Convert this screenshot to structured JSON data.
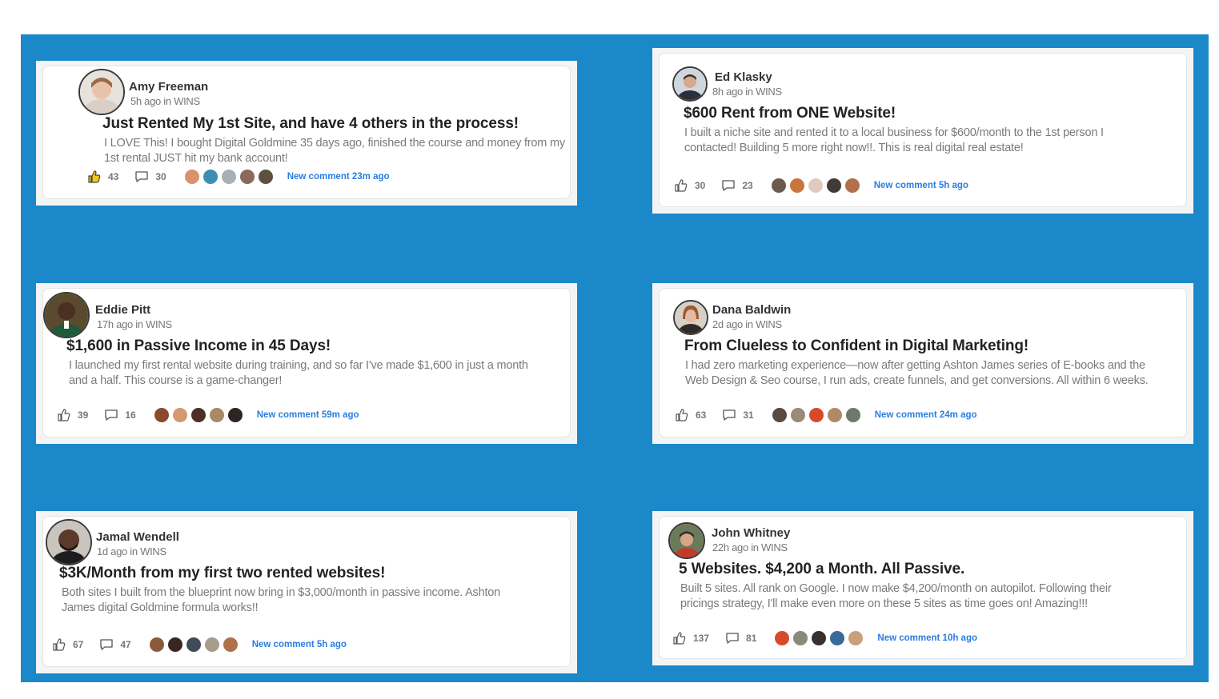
{
  "colors": {
    "background_panel": "#1a88c9",
    "link": "#2a7de1"
  },
  "posts": [
    {
      "author": "Amy Freeman",
      "meta": "5h ago in WINS",
      "title": "Just Rented My 1st Site, and have 4 others in the process!",
      "body": "I LOVE This!  I bought Digital Goldmine 35 days ago, finished the course and money from my 1st rental JUST hit my bank account!",
      "likes": "43",
      "comments": "30",
      "new_comment": "New comment 23m ago",
      "liked": true
    },
    {
      "author": "Ed Klasky",
      "meta": "8h ago in WINS",
      "title": "$600 Rent from ONE Website!",
      "body": "I built a niche site and rented it to a local business for $600/month to the 1st person I contacted! Building 5 more right now!!. This is real digital real estate!",
      "likes": "30",
      "comments": "23",
      "new_comment": "New comment 5h ago",
      "liked": false
    },
    {
      "author": "Eddie Pitt",
      "meta": "17h ago in WINS",
      "title": "$1,600 in Passive Income in 45 Days!",
      "body": "I launched my first rental website during training, and so far I've made $1,600 in just a month and a half. This course is a game-changer!",
      "likes": "39",
      "comments": "16",
      "new_comment": "New comment 59m ago",
      "liked": false
    },
    {
      "author": "Dana Baldwin",
      "meta": "2d ago in WINS",
      "title": "From Clueless to Confident in Digital Marketing!",
      "body": "I had zero marketing experience—now after getting Ashton James series of E-books and the Web Design & Seo course, I run ads, create funnels, and get conversions. All within 6 weeks.",
      "likes": "63",
      "comments": "31",
      "new_comment": "New comment 24m ago",
      "liked": false
    },
    {
      "author": "Jamal Wendell",
      "meta": "1d ago in WINS",
      "title": "$3K/Month from my first two rented websites!",
      "body": "Both sites I built from the blueprint now bring in $3,000/month in passive income. Ashton James digital Goldmine formula works!!",
      "likes": "67",
      "comments": "47",
      "new_comment": "New comment 5h ago",
      "liked": false
    },
    {
      "author": "John Whitney",
      "meta": "22h ago in WINS",
      "title": "5 Websites. $4,200 a Month. All Passive.",
      "body": "Built 5 sites. All rank on Google. I now make $4,200/month on autopilot. Following their pricings strategy, I'll make even more on these 5 sites as time goes on! Amazing!!!",
      "likes": "137",
      "comments": "81",
      "new_comment": "New comment 10h ago",
      "liked": false
    }
  ]
}
